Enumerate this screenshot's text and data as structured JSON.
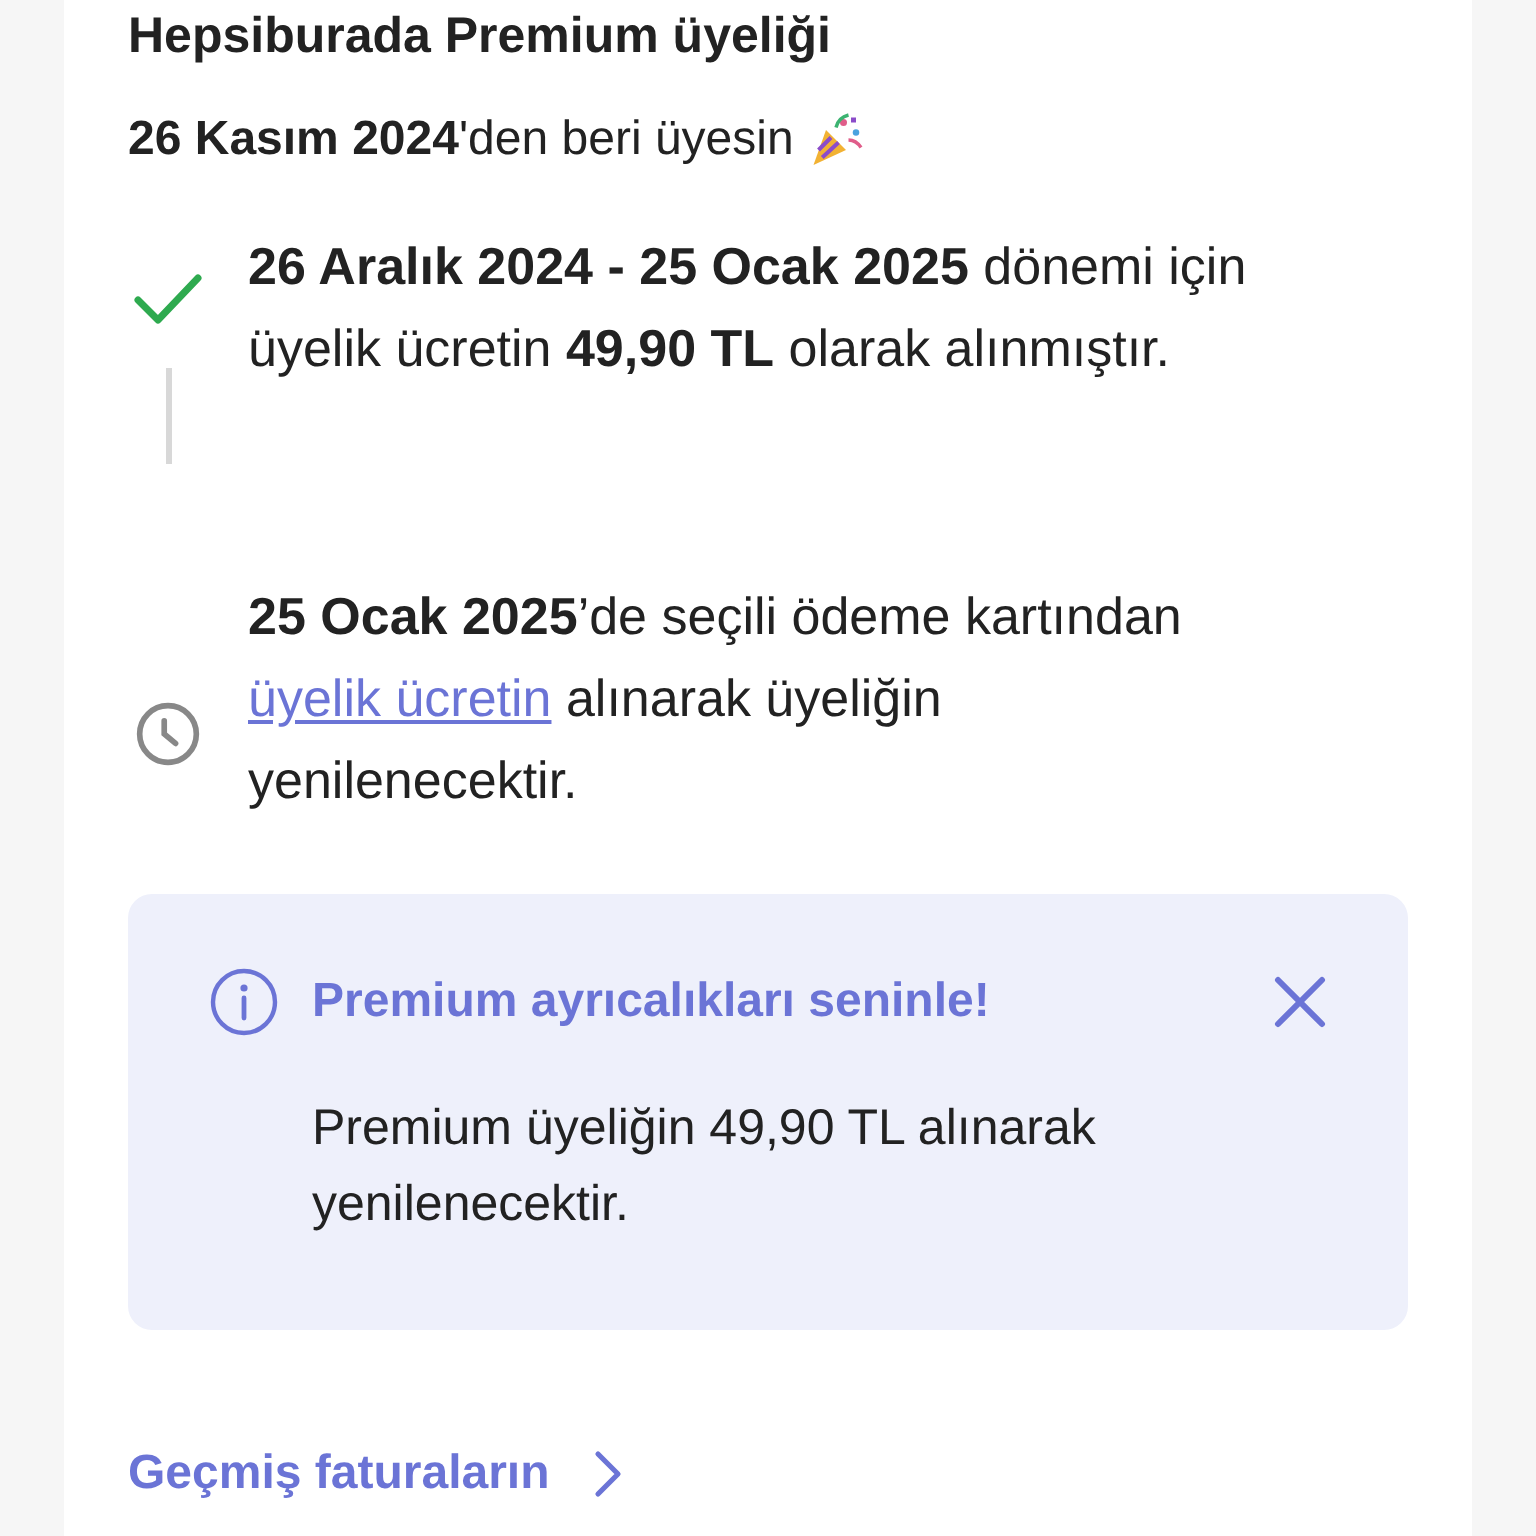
{
  "heading": "Hepsiburada Premium üyeliği",
  "member_since": "**26 Kasım 2024**'den beri üyesin",
  "timeline": [
    {
      "kind": "done",
      "parts": [
        {
          "kind": "bold",
          "text": "26 Aralık 2024 - 25 Ocak 2025"
        },
        {
          "kind": "plain",
          "text": " dönemi için üyelik ücretin "
        },
        {
          "kind": "bold",
          "text": "49,90 TL"
        },
        {
          "kind": "plain",
          "text": " olarak alınmıştır."
        }
      ]
    },
    {
      "kind": "pending",
      "parts": [
        {
          "kind": "bold",
          "text": "25 Ocak 2025"
        },
        {
          "kind": "plain",
          "text": "’de seçili ödeme kartından "
        },
        {
          "kind": "link",
          "text": "üyelik ücretin"
        },
        {
          "kind": "plain",
          "text": " alınarak üyeliğin yenilenecektir."
        }
      ]
    }
  ],
  "info_box": {
    "title": "Premium ayrıcalıkları seninle!",
    "message": "Premium üyeliğin 49,90 TL alınarak yenilenecektir."
  },
  "invoices_link": "Geçmiş faturaların"
}
